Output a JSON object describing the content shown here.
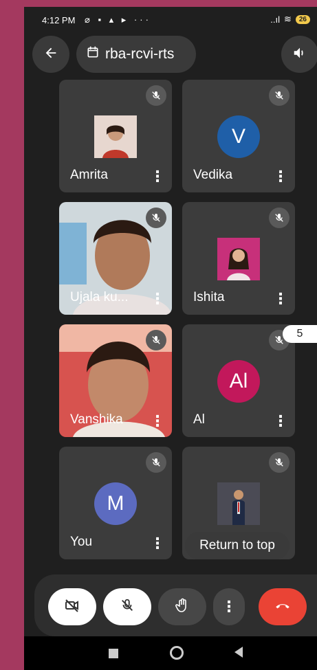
{
  "status_bar": {
    "time": "4:12 PM",
    "notification_icons": "⌀ ▪ ▴ ▸ ···",
    "signal": "..ıl",
    "wifi": "≋",
    "battery": "26"
  },
  "header": {
    "meeting_code": "rba-rcvi-rts"
  },
  "participants": [
    {
      "name": "Amrita",
      "type": "photo",
      "avatar_color": "#e7d7cf"
    },
    {
      "name": "Vedika",
      "type": "initial",
      "initial": "V",
      "avatar_color": "#1f5fa8"
    },
    {
      "name": "Ujala ku...",
      "type": "video"
    },
    {
      "name": "Ishita",
      "type": "photo",
      "avatar_color": "#c7307a"
    },
    {
      "name": "Vanshika",
      "type": "video"
    },
    {
      "name": "Al",
      "type": "initial",
      "initial": "Al",
      "avatar_color": "#c2185b"
    },
    {
      "name": "You",
      "type": "initial",
      "initial": "M",
      "avatar_color": "#5c6bc0"
    },
    {
      "name": "",
      "type": "photo",
      "avatar_color": "#5b5b66"
    }
  ],
  "overflow_count": "5",
  "return_to_top_label": "Return to top",
  "colors": {
    "end_call": "#ea4335",
    "panel": "#2e2e2e",
    "tile": "#3c3c3c"
  }
}
